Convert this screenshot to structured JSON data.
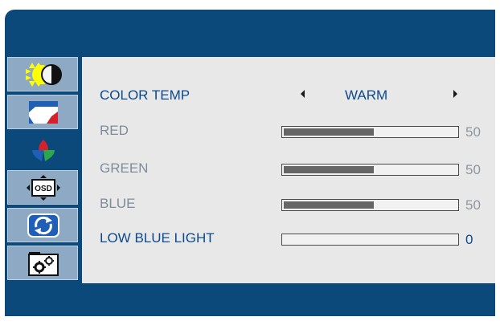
{
  "menu": {
    "tabs": [
      {
        "id": "brightness",
        "icon": "brightness-contrast-icon",
        "active": false
      },
      {
        "id": "image",
        "icon": "image-setup-icon",
        "active": false
      },
      {
        "id": "color",
        "icon": "color-setup-icon",
        "active": true
      },
      {
        "id": "osd",
        "icon": "osd-setup-icon",
        "label": "OSD",
        "active": false
      },
      {
        "id": "reset",
        "icon": "reset-icon",
        "active": false
      },
      {
        "id": "misc",
        "icon": "settings-gears-icon",
        "active": false
      }
    ]
  },
  "color_temp": {
    "label": "COLOR TEMP",
    "value": "WARM"
  },
  "sliders": [
    {
      "label": "RED",
      "value": "50",
      "fraction": 0.52,
      "highlighted": false
    },
    {
      "label": "GREEN",
      "value": "50",
      "fraction": 0.52,
      "highlighted": false
    },
    {
      "label": "BLUE",
      "value": "50",
      "fraction": 0.52,
      "highlighted": false
    },
    {
      "label": "LOW BLUE LIGHT",
      "value": "0",
      "fraction": 0.0,
      "highlighted": true
    }
  ],
  "colors": {
    "frame": "#0b497b",
    "panel": "#e8e8e8",
    "highlight": "#0b4a8d",
    "dim": "#7f8c9a"
  }
}
